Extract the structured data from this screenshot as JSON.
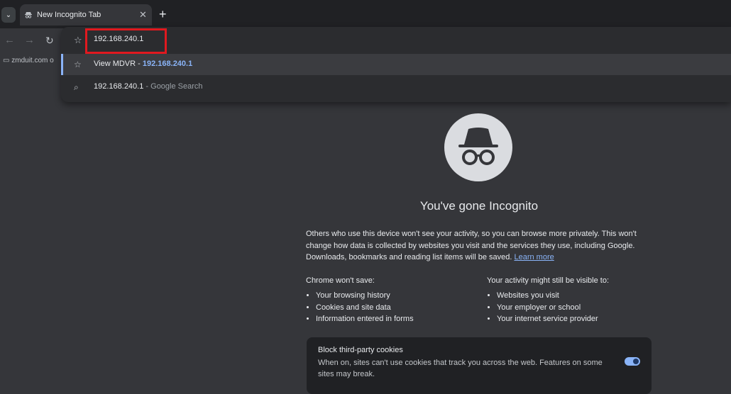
{
  "tabstrip": {
    "tab_title": "New Incognito Tab",
    "close_glyph": "✕",
    "new_tab_glyph": "+"
  },
  "toolbar": {
    "back_glyph": "←",
    "forward_glyph": "→",
    "reload_glyph": "↻"
  },
  "omnibox": {
    "value": "192.168.240.1",
    "suggestions": [
      {
        "icon": "star-icon",
        "label": "View MDVR - ",
        "url": "192.168.240.1"
      },
      {
        "icon": "search-icon",
        "label": "192.168.240.1",
        "suffix": " - Google Search"
      }
    ]
  },
  "bookmarks": {
    "item": "zmduit.com o"
  },
  "incognito": {
    "title": "You've gone Incognito",
    "intro": "Others who use this device won't see your activity, so you can browse more privately. This won't change how data is collected by websites you visit and the services they use, including Google. Downloads, bookmarks and reading list items will be saved. ",
    "learn_more": "Learn more",
    "wont_save": {
      "heading": "Chrome won't save:",
      "items": [
        "Your browsing history",
        "Cookies and site data",
        "Information entered in forms"
      ]
    },
    "visible_to": {
      "heading": "Your activity might still be visible to:",
      "items": [
        "Websites you visit",
        "Your employer or school",
        "Your internet service provider"
      ]
    },
    "cookies": {
      "title": "Block third-party cookies",
      "description": "When on, sites can't use cookies that track you across the web. Features on some sites may break.",
      "enabled": true
    }
  },
  "colors": {
    "accent": "#8ab4f8",
    "highlight_box": "#e0191f",
    "background": "#35363a"
  }
}
